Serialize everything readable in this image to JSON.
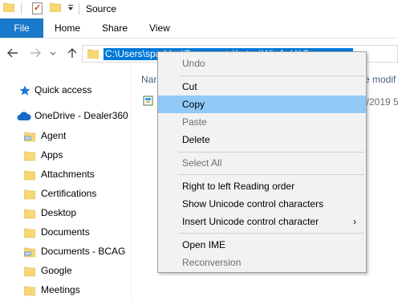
{
  "window": {
    "title": "Source"
  },
  "quick_access_toolbar": {
    "icons": [
      "folder-icon",
      "properties-icon",
      "new-folder-icon",
      "customize-dropdown-icon"
    ]
  },
  "ribbon": {
    "tabs": [
      {
        "label": "File"
      },
      {
        "label": "Home"
      },
      {
        "label": "Share"
      },
      {
        "label": "View"
      }
    ]
  },
  "address_bar": {
    "selected_text": "C:\\Users\\spaddoc\\Documents\\Lotus\\Wi_A_Ht\\Source"
  },
  "nav_pane": {
    "quick_access": "Quick access",
    "onedrive": "OneDrive - Dealer360",
    "folders": [
      {
        "label": "Agent",
        "icon": "shared-folder-icon"
      },
      {
        "label": "Apps",
        "icon": "folder-icon"
      },
      {
        "label": "Attachments",
        "icon": "folder-icon"
      },
      {
        "label": "Certifications",
        "icon": "folder-icon"
      },
      {
        "label": "Desktop",
        "icon": "folder-icon"
      },
      {
        "label": "Documents",
        "icon": "folder-icon"
      },
      {
        "label": "Documents - BCAG",
        "icon": "shared-folder-icon"
      },
      {
        "label": "Google",
        "icon": "folder-icon"
      },
      {
        "label": "Meetings",
        "icon": "folder-icon"
      }
    ]
  },
  "content": {
    "column_name_partial": "Nar",
    "column_date_partial": "e modif",
    "file_date_partial": "0/2019 5"
  },
  "context_menu": {
    "items": [
      {
        "label": "Undo",
        "disabled": true
      },
      {
        "label": "Cut",
        "disabled": false
      },
      {
        "label": "Copy",
        "disabled": false,
        "highlighted": true
      },
      {
        "label": "Paste",
        "disabled": true
      },
      {
        "label": "Delete",
        "disabled": false
      },
      {
        "label": "Select All",
        "disabled": true
      },
      {
        "label": "Right to left Reading order",
        "disabled": false
      },
      {
        "label": "Show Unicode control characters",
        "disabled": false
      },
      {
        "label": "Insert Unicode control character",
        "disabled": false,
        "submenu": true
      },
      {
        "label": "Open IME",
        "disabled": false
      },
      {
        "label": "Reconversion",
        "disabled": true
      }
    ],
    "submenu_arrow": "›"
  },
  "colors": {
    "file_tab": "#1979ca",
    "selection": "#0078d7",
    "menu_highlight": "#91c9f7",
    "folder": "#f8d775"
  }
}
